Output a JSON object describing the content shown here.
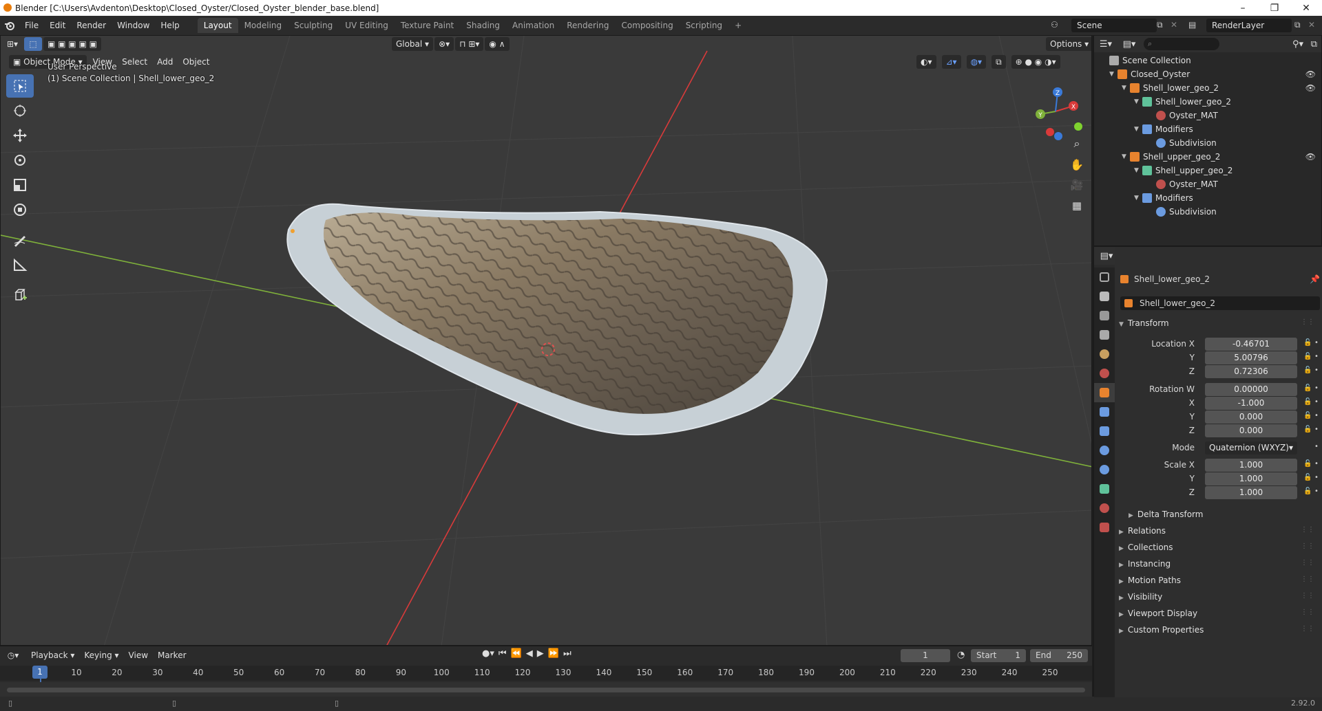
{
  "window": {
    "title": "Blender [C:\\Users\\Avdenton\\Desktop\\Closed_Oyster/Closed_Oyster_blender_base.blend]",
    "controls": [
      "–",
      "❐",
      "✕"
    ]
  },
  "menus": [
    "File",
    "Edit",
    "Render",
    "Window",
    "Help"
  ],
  "workspaces": [
    "Layout",
    "Modeling",
    "Sculpting",
    "UV Editing",
    "Texture Paint",
    "Shading",
    "Animation",
    "Rendering",
    "Compositing",
    "Scripting"
  ],
  "active_workspace": "Layout",
  "scene_name": "Scene",
  "render_layer": "RenderLayer",
  "viewport": {
    "mode": "Object Mode",
    "menus": [
      "View",
      "Select",
      "Add",
      "Object"
    ],
    "transform_orientation": "Global",
    "options_label": "Options",
    "perspective_label": "User Perspective",
    "collection_info": "(1) Scene Collection | Shell_lower_geo_2",
    "axis_labels": {
      "x": "X",
      "y": "Y",
      "z": "Z"
    },
    "colors": {
      "x_axis": "#d93a3a",
      "y_axis": "#7fb13a",
      "grid": "#444444",
      "background": "#3a3a3a"
    },
    "tools": [
      "select-box-icon",
      "cursor-icon",
      "move-icon",
      "rotate-icon",
      "scale-icon",
      "transform-icon",
      "annotate-icon",
      "measure-icon",
      "add-cube-icon"
    ]
  },
  "timeline": {
    "menus": [
      "Playback",
      "Keying",
      "View",
      "Marker"
    ],
    "current_frame": "1",
    "start_label": "Start",
    "start": "1",
    "end_label": "End",
    "end": "250",
    "ruler": [
      "1",
      "10",
      "20",
      "30",
      "40",
      "50",
      "60",
      "70",
      "80",
      "90",
      "100",
      "110",
      "120",
      "130",
      "140",
      "150",
      "160",
      "170",
      "180",
      "190",
      "200",
      "210",
      "220",
      "230",
      "240",
      "250"
    ]
  },
  "outliner": {
    "root": "Scene Collection",
    "rows": [
      {
        "label": "Closed_Oyster",
        "type": "collection",
        "eye": true
      },
      {
        "label": "Shell_lower_geo_2",
        "type": "object",
        "eye": true
      },
      {
        "label": "Shell_lower_geo_2",
        "type": "mesh",
        "eye": false
      },
      {
        "label": "Oyster_MAT",
        "type": "material",
        "eye": false
      },
      {
        "label": "Modifiers",
        "type": "modifiers",
        "eye": false
      },
      {
        "label": "Subdivision",
        "type": "modifier",
        "eye": false
      },
      {
        "label": "Shell_upper_geo_2",
        "type": "object",
        "eye": true
      },
      {
        "label": "Shell_upper_geo_2",
        "type": "mesh",
        "eye": false
      },
      {
        "label": "Oyster_MAT",
        "type": "material",
        "eye": false
      },
      {
        "label": "Modifiers",
        "type": "modifiers",
        "eye": false
      },
      {
        "label": "Subdivision",
        "type": "modifier",
        "eye": false
      }
    ]
  },
  "properties": {
    "object_name": "Shell_lower_geo_2",
    "object_field": "Shell_lower_geo_2",
    "transform_header": "Transform",
    "location": {
      "label": "Location X",
      "x": "-0.46701",
      "y": "5.00796",
      "z": "0.72306"
    },
    "rotation": {
      "label": "Rotation W",
      "w": "0.00000",
      "x": "-1.000",
      "y": "0.000",
      "z": "0.000"
    },
    "mode_label": "Mode",
    "mode_value": "Quaternion (WXYZ)",
    "scale": {
      "label": "Scale X",
      "x": "1.000",
      "y": "1.000",
      "z": "1.000"
    },
    "axis_y": "Y",
    "axis_z": "Z",
    "axis_x": "X",
    "delta_transform": "Delta Transform",
    "panels": [
      "Relations",
      "Collections",
      "Instancing",
      "Motion Paths",
      "Visibility",
      "Viewport Display",
      "Custom Properties"
    ]
  },
  "status": {
    "version": "2.92.0"
  }
}
